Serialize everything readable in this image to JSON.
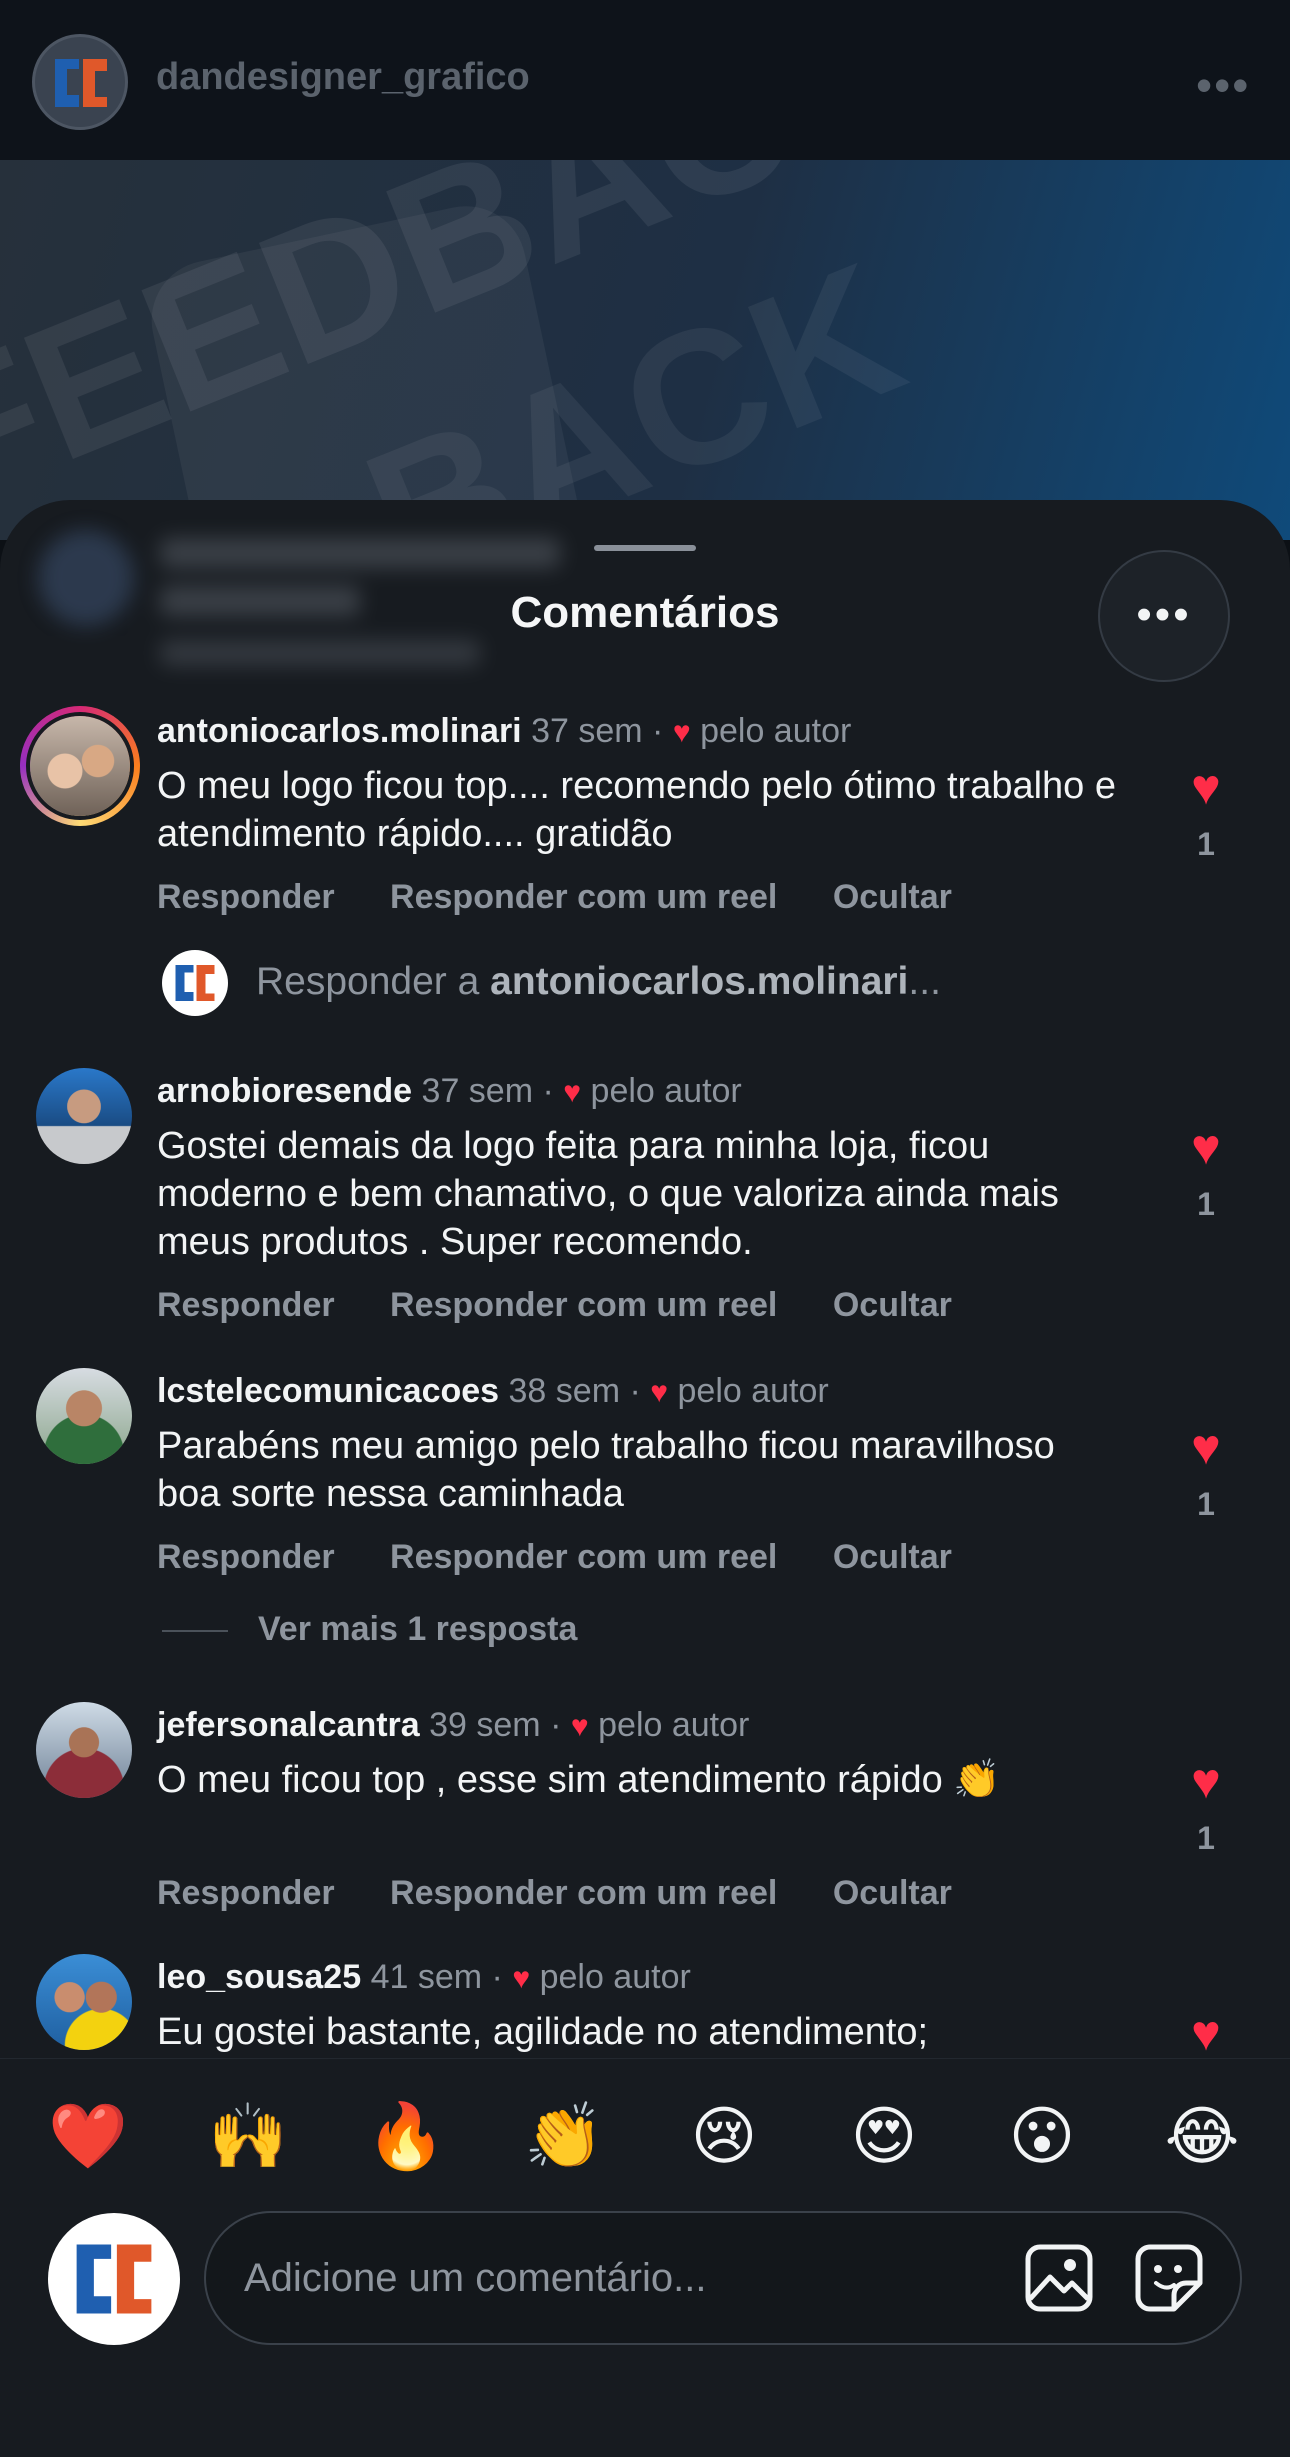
{
  "header": {
    "username": "dandesigner_grafico",
    "more_icon": "more-horizontal-icon"
  },
  "post": {
    "bg_word_1": "FEEDBACK",
    "bg_word_2": "BACK"
  },
  "sheet": {
    "title": "Comentários"
  },
  "comments": [
    {
      "username": "antoniocarlos.molinari",
      "time": "37 sem",
      "liked_by_author": "pelo autor",
      "text": "O meu logo ficou top.... recomendo pelo ótimo trabalho e atendimento rápido.... gratidão",
      "likes": "1",
      "actions": [
        "Responder",
        "Responder com um reel",
        "Ocultar"
      ]
    },
    {
      "username": "arnobioresende",
      "time": "37 sem",
      "liked_by_author": "pelo autor",
      "text": "Gostei demais da logo feita para minha loja, ficou moderno e bem chamativo, o que valoriza ainda mais meus produtos . Super recomendo.",
      "likes": "1",
      "actions": [
        "Responder",
        "Responder com um reel",
        "Ocultar"
      ]
    },
    {
      "username": "lcstelecomunicacoes",
      "time": "38 sem",
      "liked_by_author": "pelo autor",
      "text": "Parabéns meu amigo pelo trabalho ficou maravilhoso boa sorte nessa caminhada",
      "likes": "1",
      "actions": [
        "Responder",
        "Responder com um reel",
        "Ocultar"
      ]
    },
    {
      "username": "jefersonalcantra",
      "time": "39 sem",
      "liked_by_author": "pelo autor",
      "text": "O meu ficou top , esse sim atendimento rápido 👏",
      "likes": "1",
      "actions": [
        "Responder",
        "Responder com um reel",
        "Ocultar"
      ]
    },
    {
      "username": "leo_sousa25",
      "time": "41 sem",
      "liked_by_author": "pelo autor",
      "text": "Eu gostei bastante, agilidade no atendimento;"
    }
  ],
  "reply_prompt": {
    "prefix": "Responder a ",
    "target": "antoniocarlos.molinari",
    "suffix": "..."
  },
  "view_more_replies": "Ver mais 1 resposta",
  "emoji_bar": [
    "❤️",
    "🙌",
    "🔥",
    "👏",
    "😢",
    "😍",
    "😮",
    "😂"
  ],
  "composer": {
    "placeholder": "Adicione um comentário...",
    "gallery_icon": "image-icon",
    "sticker_icon": "sticker-icon"
  },
  "colors": {
    "like_red": "#ff2d48",
    "sheet_bg": "#171b20",
    "muted_text": "#8e959e"
  }
}
